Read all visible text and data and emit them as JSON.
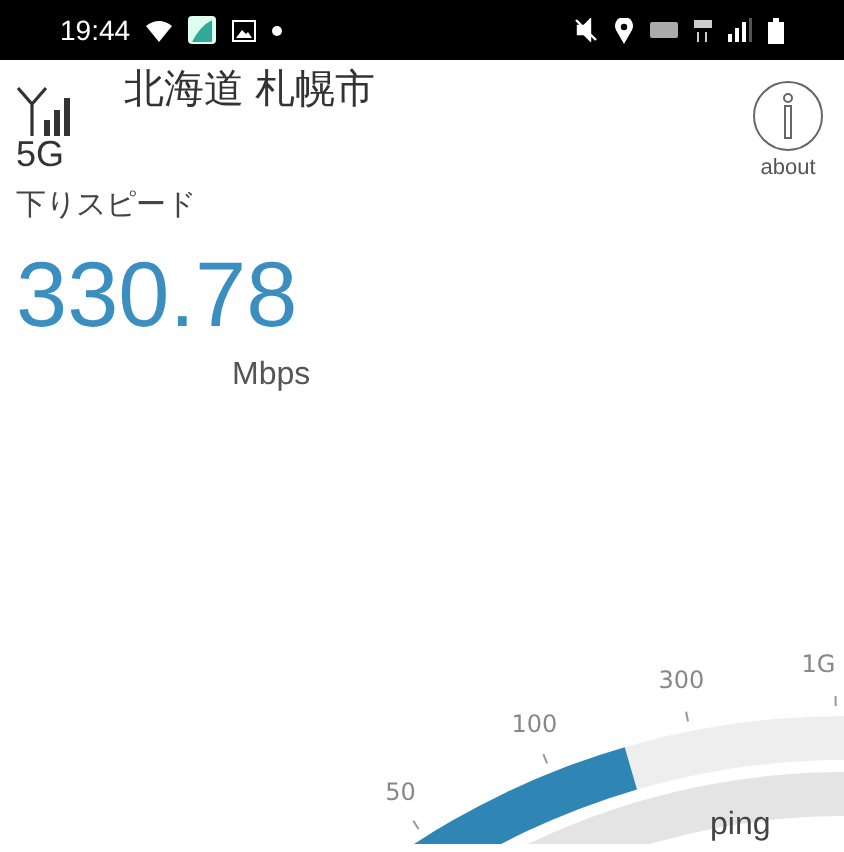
{
  "status_bar": {
    "time": "19:44"
  },
  "header": {
    "location": "北海道 札幌市",
    "network": "5G",
    "about_label": "about"
  },
  "speed": {
    "label": "下りスピード",
    "value": "330.78",
    "unit": "Mbps"
  },
  "gauge": {
    "ticks": [
      "50",
      "100",
      "300",
      "1G"
    ],
    "inner_label": "ping"
  }
}
